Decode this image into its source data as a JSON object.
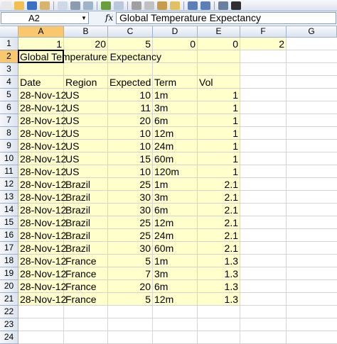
{
  "toolbar": {
    "icons": [
      "new-icon",
      "open-icon",
      "save-icon",
      "permission-icon",
      "email-icon",
      "print-icon",
      "print-preview-icon",
      "spelling-icon",
      "research-icon",
      "cut-icon",
      "copy-icon",
      "paste-icon",
      "format-painter-icon",
      "undo-icon",
      "redo-icon",
      "hyperlink-icon",
      "autosum-icon"
    ]
  },
  "formula_bar": {
    "name_box": "A2",
    "fx": "fx",
    "content": "Global Temperature Expectancy"
  },
  "columns": [
    "A",
    "B",
    "C",
    "D",
    "E",
    "F",
    "G"
  ],
  "rows": [
    "1",
    "2",
    "3",
    "4",
    "5",
    "6",
    "7",
    "8",
    "9",
    "10",
    "11",
    "12",
    "13",
    "14",
    "15",
    "16",
    "17",
    "18",
    "19",
    "20",
    "21",
    "22",
    "23",
    "24"
  ],
  "row1": {
    "A": "1",
    "B": "20",
    "C": "5",
    "D": "0",
    "E": "0",
    "F": "2"
  },
  "title_cell": "Global Temperature Expectancy",
  "headers": {
    "date": "Date",
    "region": "Region",
    "expected": "Expected '",
    "term": "Term",
    "vol": "Vol"
  },
  "data": [
    {
      "date": "28-Nov-12",
      "region": "US",
      "expected": "10",
      "term": "1m",
      "vol": "1"
    },
    {
      "date": "28-Nov-12",
      "region": "US",
      "expected": "11",
      "term": "3m",
      "vol": "1"
    },
    {
      "date": "28-Nov-12",
      "region": "US",
      "expected": "20",
      "term": "6m",
      "vol": "1"
    },
    {
      "date": "28-Nov-12",
      "region": "US",
      "expected": "10",
      "term": "12m",
      "vol": "1"
    },
    {
      "date": "28-Nov-12",
      "region": "US",
      "expected": "10",
      "term": "24m",
      "vol": "1"
    },
    {
      "date": "28-Nov-12",
      "region": "US",
      "expected": "15",
      "term": "60m",
      "vol": "1"
    },
    {
      "date": "28-Nov-12",
      "region": "US",
      "expected": "10",
      "term": "120m",
      "vol": "1"
    },
    {
      "date": "28-Nov-12",
      "region": "Brazil",
      "expected": "25",
      "term": "1m",
      "vol": "2.1"
    },
    {
      "date": "28-Nov-12",
      "region": "Brazil",
      "expected": "30",
      "term": "3m",
      "vol": "2.1"
    },
    {
      "date": "28-Nov-12",
      "region": "Brazil",
      "expected": "30",
      "term": "6m",
      "vol": "2.1"
    },
    {
      "date": "28-Nov-12",
      "region": "Brazil",
      "expected": "25",
      "term": "12m",
      "vol": "2.1"
    },
    {
      "date": "28-Nov-12",
      "region": "Brazil",
      "expected": "25",
      "term": "24m",
      "vol": "2.1"
    },
    {
      "date": "28-Nov-12",
      "region": "Brazil",
      "expected": "30",
      "term": "60m",
      "vol": "2.1"
    },
    {
      "date": "28-Nov-12",
      "region": "France",
      "expected": "5",
      "term": "1m",
      "vol": "1.3"
    },
    {
      "date": "28-Nov-12",
      "region": "France",
      "expected": "7",
      "term": "3m",
      "vol": "1.3"
    },
    {
      "date": "28-Nov-12",
      "region": "France",
      "expected": "20",
      "term": "6m",
      "vol": "1.3"
    },
    {
      "date": "28-Nov-12",
      "region": "France",
      "expected": "5",
      "term": "12m",
      "vol": "1.3"
    }
  ],
  "colors": {
    "highlight": "#ffffcc",
    "header_selected": "#f9c76e",
    "grid": "#d4d4d4"
  }
}
